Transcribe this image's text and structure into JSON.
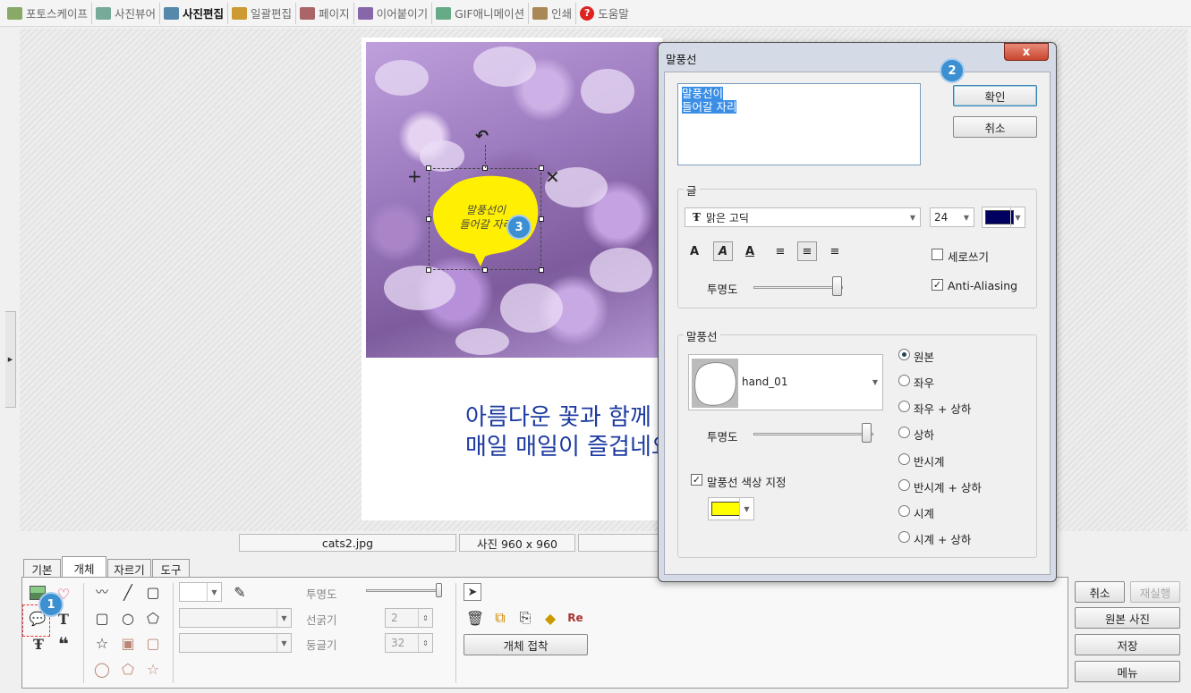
{
  "topmenu": {
    "items": [
      {
        "label": "포토스케이프",
        "color": "#8a6"
      },
      {
        "label": "사진뷰어",
        "color": "#7a9"
      },
      {
        "label": "사진편집",
        "color": "#58a"
      },
      {
        "label": "일괄편집",
        "color": "#c93"
      },
      {
        "label": "페이지",
        "color": "#a66"
      },
      {
        "label": "이어붙이기",
        "color": "#86a"
      },
      {
        "label": "GIF애니메이션",
        "color": "#6a8"
      },
      {
        "label": "인쇄",
        "color": "#a85"
      },
      {
        "label": "도움말",
        "color": "#d22"
      }
    ],
    "active_index": 2
  },
  "canvas": {
    "caption_line1": "아름다운 꽃과 함께",
    "caption_line2": "매일 매일이 즐겁네요",
    "bubble_line1": "말풍선이",
    "bubble_line2": "들어갈 자리",
    "bubble_color": "#ffef00"
  },
  "badges": {
    "b1": "1",
    "b2": "2",
    "b3": "3"
  },
  "status": {
    "filename": "cats2.jpg",
    "size": "사진 960 x 960"
  },
  "tabs": [
    "기본",
    "개체",
    "자르기",
    "도구"
  ],
  "active_tab": 1,
  "panel": {
    "opacity_label": "투명도",
    "line_width_label": "선굵기",
    "line_width_value": "2",
    "roundness_label": "둥글기",
    "roundness_value": "32",
    "attach_button": "개체 접착"
  },
  "right_buttons": {
    "cancel": "취소",
    "redo": "재실행",
    "original": "원본 사진",
    "save": "저장",
    "menu": "메뉴"
  },
  "dialog": {
    "title": "말풍선",
    "close": "x",
    "text_line1": "말풍선이",
    "text_line2": "들어갈 자리",
    "ok": "확인",
    "cancel": "취소",
    "text_group": "글",
    "font_name": "맑은 고딕",
    "font_size": "24",
    "font_color": "#000060",
    "vertical_label": "세로쓰기",
    "vertical_checked": false,
    "antialias_label": "Anti-Aliasing",
    "antialias_checked": true,
    "text_opacity_label": "투명도",
    "text_opacity": 1.0,
    "bubble_group": "말풍선",
    "shape_name": "hand_01",
    "bubble_opacity_label": "투명도",
    "bubble_opacity": 1.0,
    "color_check_label": "말풍선 색상 지정",
    "color_checked": true,
    "bubble_color": "#ffff00",
    "orientations": [
      "원본",
      "좌우",
      "좌우 + 상하",
      "상하",
      "반시계",
      "반시계 + 상하",
      "시계",
      "시계 + 상하"
    ],
    "orientation_selected": 0
  }
}
